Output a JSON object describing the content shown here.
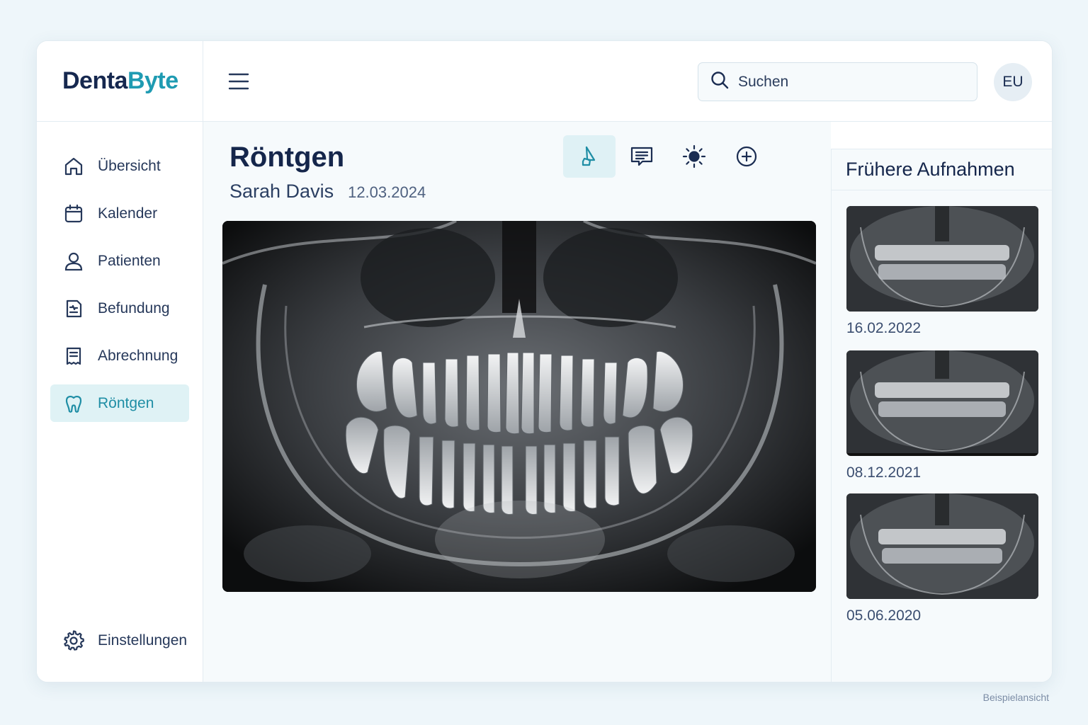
{
  "app": {
    "logo_part1": "Denta",
    "logo_part2": "Byte",
    "brand_color": "#1f9bb2",
    "dark_color": "#16284f"
  },
  "header": {
    "search_placeholder": "Suchen",
    "avatar_initials": "EU"
  },
  "sidebar": {
    "items": [
      {
        "label": "Übersicht",
        "icon": "home-icon",
        "active": false
      },
      {
        "label": "Kalender",
        "icon": "calendar-icon",
        "active": false
      },
      {
        "label": "Patienten",
        "icon": "user-icon",
        "active": false
      },
      {
        "label": "Befundung",
        "icon": "findings-icon",
        "active": false
      },
      {
        "label": "Abrechnung",
        "icon": "invoice-icon",
        "active": false
      },
      {
        "label": "Röntgen",
        "icon": "tooth-icon",
        "active": true
      }
    ],
    "settings_label": "Einstellungen"
  },
  "main": {
    "title": "Röntgen",
    "patient_name": "Sarah Davis",
    "image_date": "12.03.2024",
    "tools": [
      {
        "icon": "annotate-icon",
        "active": true
      },
      {
        "icon": "comment-icon",
        "active": false
      },
      {
        "icon": "brightness-icon",
        "active": false
      },
      {
        "icon": "zoom-in-icon",
        "active": false
      }
    ]
  },
  "previous": {
    "title": "Frühere Aufnahmen",
    "items": [
      {
        "date": "16.02.2022"
      },
      {
        "date": "08.12.2021"
      },
      {
        "date": "05.06.2020"
      }
    ]
  },
  "footnote": "Beispielansicht"
}
